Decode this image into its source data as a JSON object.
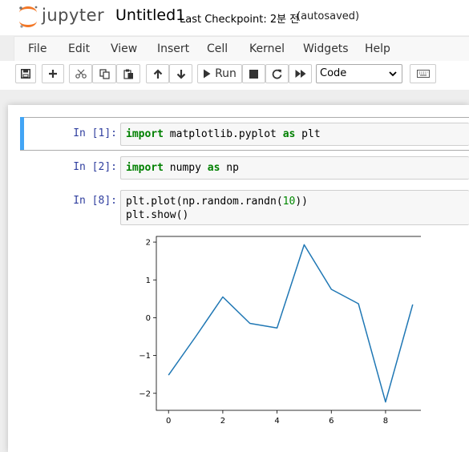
{
  "header": {
    "logo_text": "jupyter",
    "notebook_name": "Untitled1",
    "checkpoint": "Last Checkpoint: 2분 전",
    "autosaved": "(autosaved)"
  },
  "menu": {
    "items": [
      "File",
      "Edit",
      "View",
      "Insert",
      "Cell",
      "Kernel",
      "Widgets",
      "Help"
    ]
  },
  "toolbar": {
    "run_label": "Run",
    "cell_type": "Code"
  },
  "cells": [
    {
      "prompt": "In [1]:",
      "kw1": "import",
      "t1": " matplotlib.pyplot ",
      "kw2": "as",
      "t2": " plt"
    },
    {
      "prompt": "In [2]:",
      "kw1": "import",
      "t1": " numpy ",
      "kw2": "as",
      "t2": " np"
    },
    {
      "prompt": "In [8]:",
      "line1_a": "plt.plot(np.random.randn(",
      "line1_num": "10",
      "line1_b": "))",
      "line2": "plt.show()"
    }
  ],
  "chart_data": {
    "type": "line",
    "title": "",
    "xlabel": "",
    "ylabel": "",
    "xlim": [
      -0.45,
      9.45
    ],
    "ylim": [
      -2.45,
      2.15
    ],
    "xticks": [
      0,
      2,
      4,
      6,
      8
    ],
    "yticks": [
      2,
      1,
      0,
      -1,
      -2
    ],
    "xtick_labels": [
      "0",
      "2",
      "4",
      "6",
      "8"
    ],
    "ytick_labels": [
      "2",
      "1",
      "0",
      "−1",
      "−2"
    ],
    "line_color": "#1f77b4",
    "grid": false,
    "series": [
      {
        "x": [
          0,
          1,
          2,
          3,
          4,
          5,
          6,
          7,
          8,
          9
        ],
        "values": [
          -1.52,
          -0.5,
          0.55,
          -0.15,
          -0.27,
          1.93,
          0.75,
          0.37,
          -2.23,
          0.35
        ]
      }
    ]
  }
}
